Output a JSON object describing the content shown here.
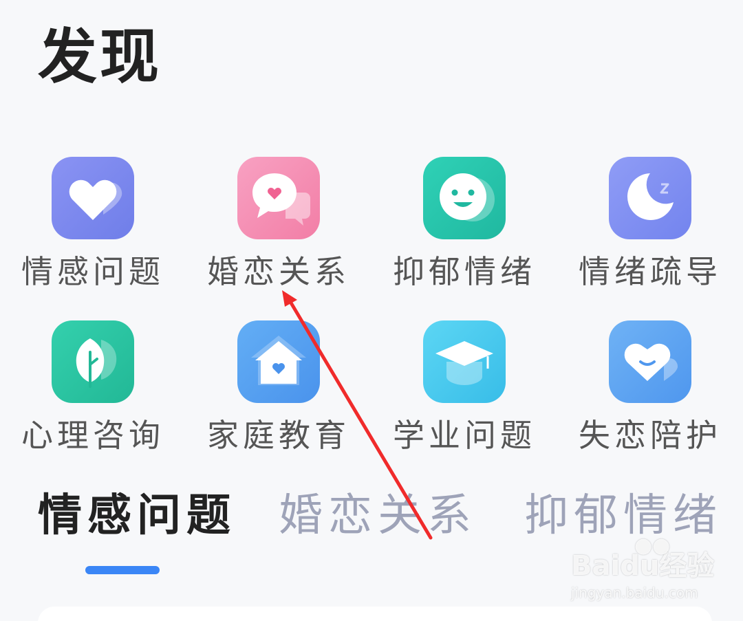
{
  "page_title": "发现",
  "categories": [
    {
      "label": "情感问题",
      "icon": "heart-icon",
      "color": "#7e8af0"
    },
    {
      "label": "婚恋关系",
      "icon": "chat-heart-icon",
      "color": "#f48fb1"
    },
    {
      "label": "抑郁情绪",
      "icon": "smile-icon",
      "color": "#2ec7b0"
    },
    {
      "label": "情绪疏导",
      "icon": "moon-icon",
      "color": "#8193f5"
    },
    {
      "label": "心理咨询",
      "icon": "leaf-icon",
      "color": "#2fc8a6"
    },
    {
      "label": "家庭教育",
      "icon": "home-heart-icon",
      "color": "#5aa5f2"
    },
    {
      "label": "学业问题",
      "icon": "graduation-cap-icon",
      "color": "#4cc9ef"
    },
    {
      "label": "失恋陪护",
      "icon": "heart-smile-icon",
      "color": "#5ca3f2"
    }
  ],
  "tabs": [
    {
      "label": "情感问题",
      "active": true
    },
    {
      "label": "婚恋关系",
      "active": false
    },
    {
      "label": "抑郁情绪",
      "active": false
    }
  ],
  "accent": "#3b86f6",
  "watermark": {
    "logo": "Baidu经验",
    "url": "jingyan.baidu.com"
  }
}
